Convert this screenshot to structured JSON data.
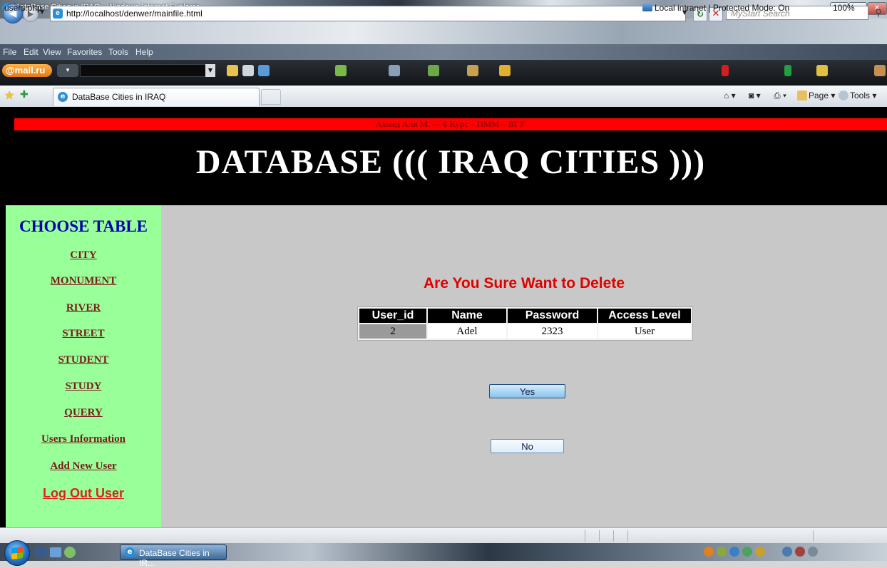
{
  "window": {
    "title": "DataBase Cities in IRAQ - Windows Internet Explorer",
    "minimize_glyph": "–",
    "maximize_glyph": "▫",
    "close_glyph": "✕"
  },
  "addressbar": {
    "url": "http://localhost/denwer/mainfile.html",
    "search_placeholder": "MyStart Search",
    "back_glyph": "◀",
    "forward_glyph": "▶",
    "refresh_glyph": "↻",
    "stop_glyph": "✕",
    "search_glyph": "⚲"
  },
  "menubar": {
    "items": [
      "File",
      "Edit",
      "View",
      "Favorites",
      "Tools",
      "Help"
    ]
  },
  "mailru_toolbar": {
    "logo": "@mail.ru"
  },
  "tabbar": {
    "active_tab_label": "DataBase Cities in IRAQ",
    "commands": {
      "home_glyph": "⌂",
      "feeds_glyph": "◙",
      "print_glyph": "⎙",
      "page_label": "Page",
      "tools_label": "Tools"
    }
  },
  "page": {
    "author_line": "Ахмед Аля М. — 6 Курс – ПММ – ВГУ",
    "banner_title": "DATABASE ((( IRAQ CITIES )))",
    "sidebar": {
      "heading": "CHOOSE TABLE",
      "links": [
        "CITY",
        "MONUMENT",
        "RIVER",
        "STREET",
        "STUDENT",
        "STUDY",
        "QUERY",
        "Users Information",
        "Add New User",
        "Log Out User"
      ]
    },
    "confirm": {
      "heading": "Are You Sure Want to Delete",
      "table": {
        "headers": [
          "User_id",
          "Name",
          "Password",
          "Access Level"
        ],
        "rows": [
          [
            "2",
            "Adel",
            "2323",
            "User"
          ]
        ]
      },
      "yes_label": "Yes",
      "no_label": "No"
    }
  },
  "statusbar": {
    "left_text": "users.php",
    "zone_text": "Local intranet | Protected Mode: On",
    "zoom_text": "100%"
  },
  "taskbar": {
    "ie_button_label": "DataBase Cities in IR..."
  },
  "colors": {
    "sidebar_bg": "#99ff99",
    "author_bar_bg": "#ff0000",
    "heading_blue": "#0000b0",
    "confirm_red": "#e00000",
    "main_bg": "#c8c8c8"
  }
}
